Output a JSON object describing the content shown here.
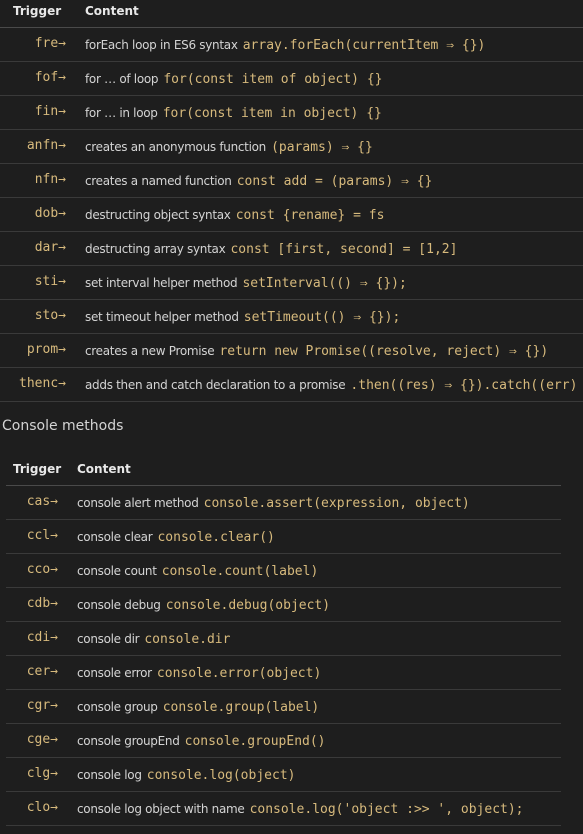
{
  "table1": {
    "headers": {
      "trigger": "Trigger",
      "content": "Content"
    },
    "rows": [
      {
        "trigger": "fre→",
        "desc": "forEach loop in ES6 syntax",
        "code": "array.forEach(currentItem ⇒ {})"
      },
      {
        "trigger": "fof→",
        "desc": "for … of loop",
        "code": "for(const item of object) {}"
      },
      {
        "trigger": "fin→",
        "desc": "for … in loop",
        "code": "for(const item in object) {}"
      },
      {
        "trigger": "anfn→",
        "desc": "creates an anonymous function",
        "code": "(params) ⇒ {}"
      },
      {
        "trigger": "nfn→",
        "desc": "creates a named function",
        "code": "const add = (params) ⇒ {}"
      },
      {
        "trigger": "dob→",
        "desc": "destructing object syntax",
        "code": "const {rename} = fs"
      },
      {
        "trigger": "dar→",
        "desc": "destructing array syntax",
        "code": "const [first, second] = [1,2]"
      },
      {
        "trigger": "sti→",
        "desc": "set interval helper method",
        "code": "setInterval(() ⇒ {});"
      },
      {
        "trigger": "sto→",
        "desc": "set timeout helper method",
        "code": "setTimeout(() ⇒ {});"
      },
      {
        "trigger": "prom→",
        "desc": "creates a new Promise",
        "code": "return new Promise((resolve, reject) ⇒ {})"
      },
      {
        "trigger": "thenc→",
        "desc": "adds then and catch declaration to a promise",
        "code": ".then((res) ⇒ {}).catch((err) ⇒ {})"
      }
    ]
  },
  "section2": {
    "title": "Console methods"
  },
  "table2": {
    "headers": {
      "trigger": "Trigger",
      "content": "Content"
    },
    "rows": [
      {
        "trigger": "cas→",
        "desc": "console alert method",
        "code": "console.assert(expression, object)"
      },
      {
        "trigger": "ccl→",
        "desc": "console clear",
        "code": "console.clear()"
      },
      {
        "trigger": "cco→",
        "desc": "console count",
        "code": "console.count(label)"
      },
      {
        "trigger": "cdb→",
        "desc": "console debug",
        "code": "console.debug(object)"
      },
      {
        "trigger": "cdi→",
        "desc": "console dir",
        "code": "console.dir"
      },
      {
        "trigger": "cer→",
        "desc": "console error",
        "code": "console.error(object)"
      },
      {
        "trigger": "cgr→",
        "desc": "console group",
        "code": "console.group(label)"
      },
      {
        "trigger": "cge→",
        "desc": "console groupEnd",
        "code": "console.groupEnd()"
      },
      {
        "trigger": "clg→",
        "desc": "console log",
        "code": "console.log(object)"
      },
      {
        "trigger": "clo→",
        "desc": "console log object with name",
        "code": "console.log('object :>> ', object);"
      }
    ]
  }
}
